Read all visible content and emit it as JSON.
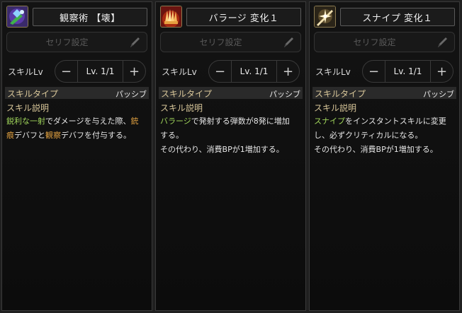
{
  "panels": [
    {
      "title": "観察術 【壊】",
      "icon": "observation-skill-icon",
      "serif_placeholder": "セリフ設定",
      "lv_label": "スキルLv",
      "level": "Lv. 1/1",
      "minus": "−",
      "plus": "+",
      "type_label": "スキルタイプ",
      "type_value": "パッシブ",
      "desc_label": "スキル説明",
      "desc": {
        "l1a": "鋭利な一射",
        "l1b": "でダメージを与えた際、",
        "l1c": "銃",
        "l2a": "痕",
        "l2b": "デバフと",
        "l2c": "観察",
        "l2d": "デバフを付与する。"
      }
    },
    {
      "title": "バラージ 変化１",
      "icon": "barrage-skill-icon",
      "serif_placeholder": "セリフ設定",
      "lv_label": "スキルLv",
      "level": "Lv. 1/1",
      "minus": "−",
      "plus": "+",
      "type_label": "スキルタイプ",
      "type_value": "パッシブ",
      "desc_label": "スキル説明",
      "desc": {
        "l1a": "バラージ",
        "l1b": "で発射する弾数が8発に増加",
        "l2": "する。",
        "l3": "その代わり、消費BPが1増加する。"
      }
    },
    {
      "title": "スナイプ 変化１",
      "icon": "snipe-skill-icon",
      "serif_placeholder": "セリフ設定",
      "lv_label": "スキルLv",
      "level": "Lv. 1/1",
      "minus": "−",
      "plus": "+",
      "type_label": "スキルタイプ",
      "type_value": "パッシブ",
      "desc_label": "スキル説明",
      "desc": {
        "l1a": "スナイプ",
        "l1b": "をインスタントスキルに変更",
        "l2": "し、必ずクリティカルになる。",
        "l3": "その代わり、消費BPが1増加する。"
      }
    }
  ],
  "colors": {
    "highlight_green": "#9fd45a",
    "highlight_orange": "#e0a040",
    "header_label": "#d9c79a"
  }
}
